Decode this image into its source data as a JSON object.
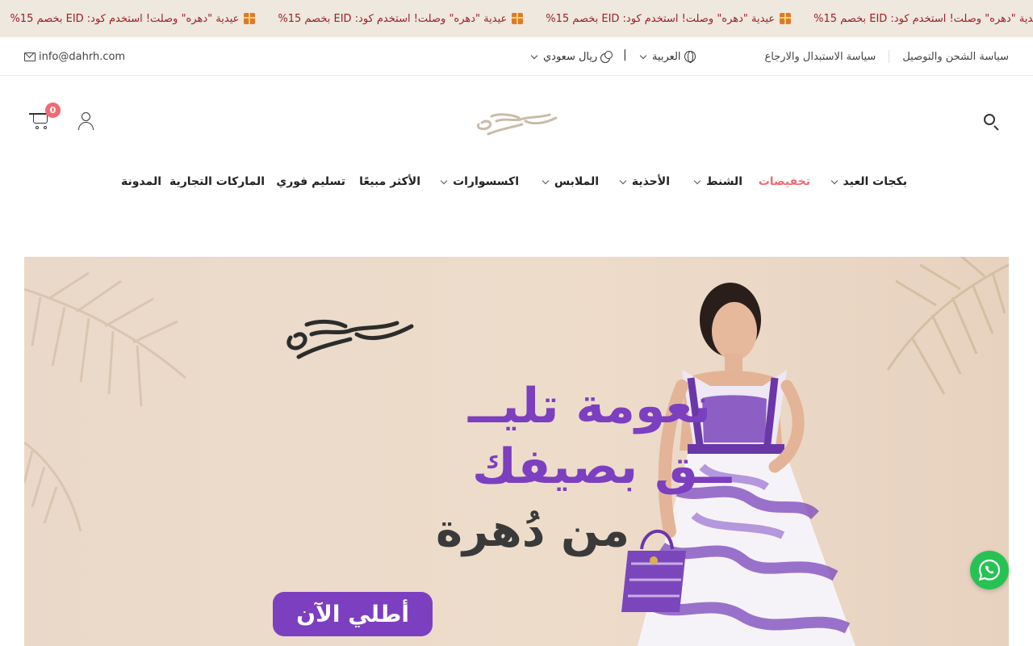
{
  "announcement": {
    "items": [
      "عيدية \"دهره\" وصلت! استخدم كود: EID بخصم 15%",
      "عيدية \"دهره\" وصلت! استخدم كود: EID بخصم 15%",
      "عيدية \"دهره\" وصلت! استخدم كود: EID بخصم 15%",
      "عيدية \"دهره\" وصلت! استخدم كود: EID بخصم 15%"
    ],
    "icon": "gift-icon",
    "text_color": "#9c1f1f",
    "background": "#eee8df"
  },
  "utility": {
    "links": [
      "سياسة الشحن والتوصيل",
      "سياسة الاستبدال والارجاع"
    ],
    "language": "العربية",
    "currency": "ريال سعودي",
    "email": "info@dahrh.com"
  },
  "header": {
    "logo_text": "دهره",
    "cart_count": "0",
    "accent": "#ef6b73"
  },
  "nav": {
    "items": [
      {
        "label": "بكجات العيد",
        "dropdown": true
      },
      {
        "label": "تخفيضات",
        "dropdown": false
      },
      {
        "label": "الشنط",
        "dropdown": true
      },
      {
        "label": "الأحذية",
        "dropdown": true
      },
      {
        "label": "الملابس",
        "dropdown": true
      },
      {
        "label": "اكسسوارات",
        "dropdown": true
      },
      {
        "label": "الأكثر مبيعًا",
        "dropdown": false
      },
      {
        "label": "تسليم فوري",
        "dropdown": false
      },
      {
        "label": "الماركات التجارية",
        "dropdown": false
      },
      {
        "label": "المدونة",
        "dropdown": false
      }
    ]
  },
  "hero": {
    "logo_text": "دهره",
    "headline_1": "نعومة تليــ",
    "headline_2": "ــق بصيفك",
    "headline_3": "من دُهرة",
    "cta": "أطلي الآن",
    "purple": "#7c3fc0"
  },
  "whatsapp": {
    "icon": "whatsapp-icon",
    "color": "#28c254"
  }
}
